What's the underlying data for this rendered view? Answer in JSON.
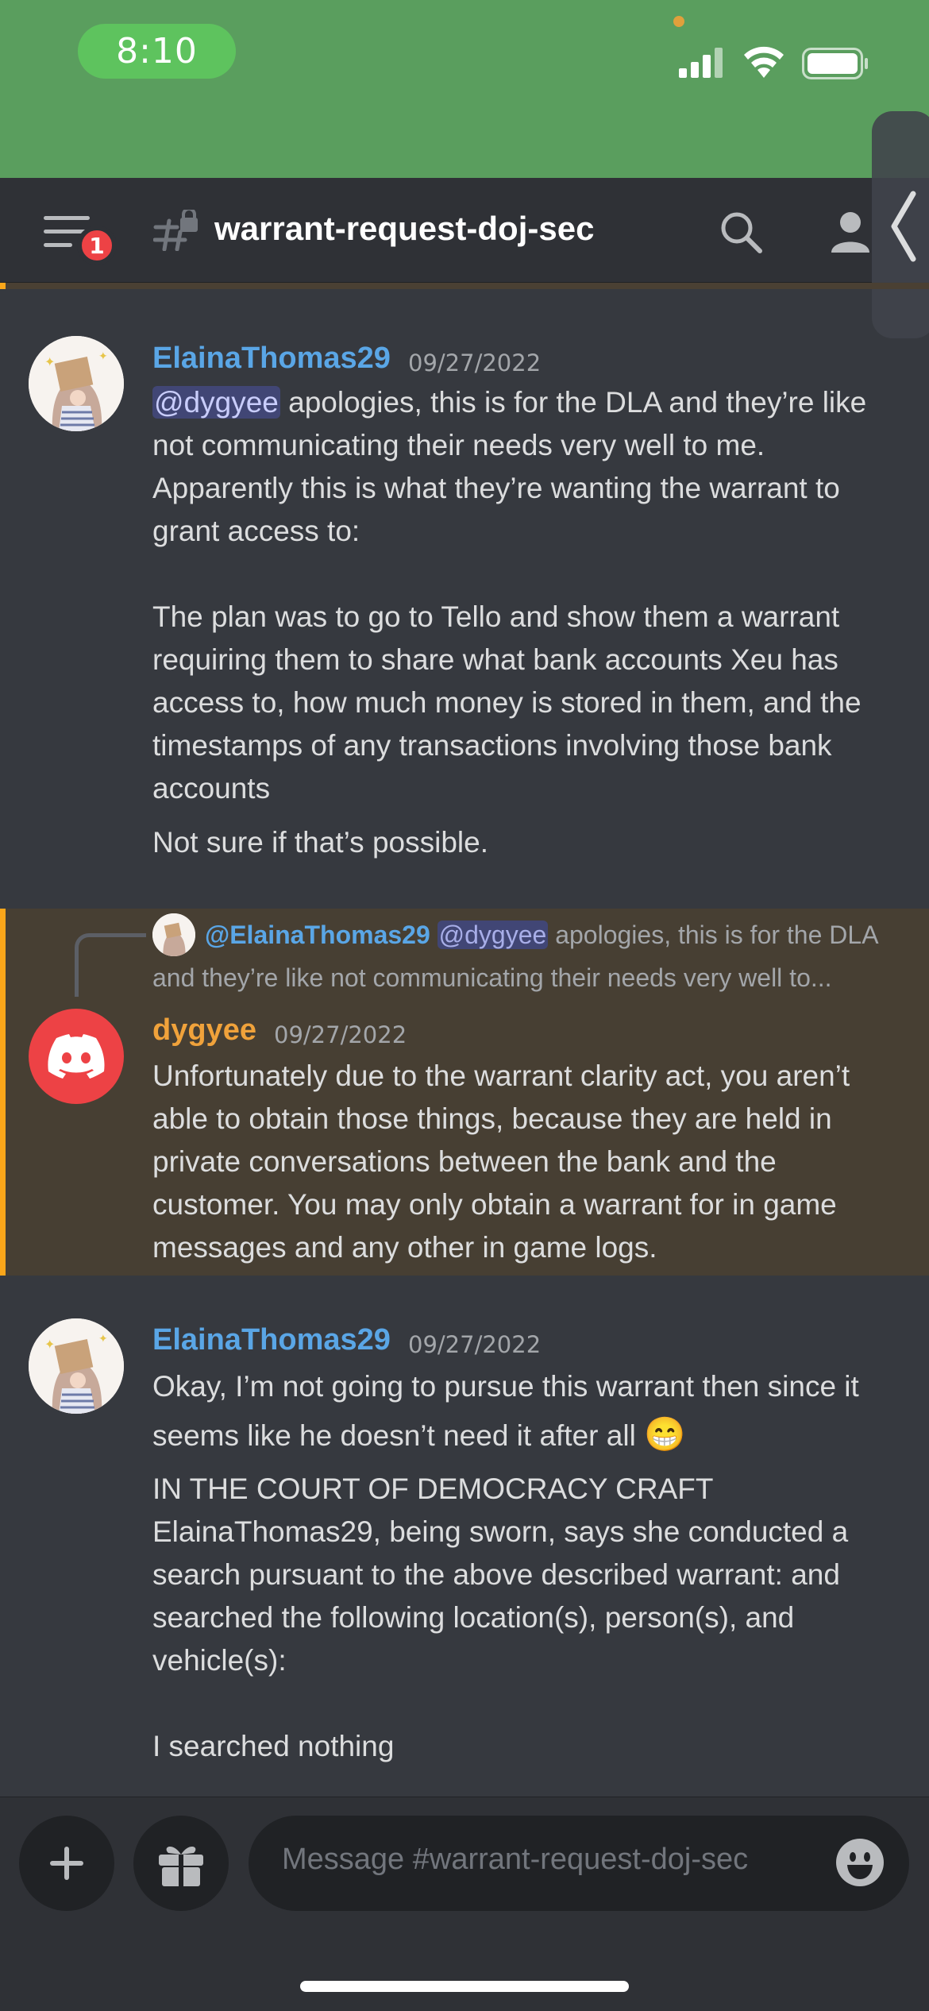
{
  "status_bar": {
    "time": "8:10"
  },
  "header": {
    "notification_count": "1",
    "channel_name": "warrant-request-doj-sec"
  },
  "messages": [
    {
      "author": "ElainaThomas29",
      "author_color": "#5aa6e6",
      "timestamp": "09/27/2022",
      "mention": "@dygyee",
      "text_first": " apologies, this is for the DLA and they’re like not communicating their needs very well to me. Apparently this is what they’re wanting the warrant to grant access to:\n\nThe plan was to go to Tello and show them a warrant requiring them to share what bank accounts Xeu has access to, how much money is stored in them, and the timestamps of any transactions involving those bank accounts",
      "text_second": "Not sure if that’s possible."
    },
    {
      "reply": {
        "author": "@ElainaThomas29",
        "mention": "@dygyee",
        "snippet": " apologies, this is for the DLA and they’re like not communicating their needs very well to..."
      },
      "author": "dygyee",
      "author_color": "#f0a23b",
      "timestamp": "09/27/2022",
      "text": "Unfortunately due to the warrant clarity act, you aren’t able to obtain those things, because they are held in private conversations between the bank and the customer. You may only obtain a warrant for in game messages and any other in game logs."
    },
    {
      "author": "ElainaThomas29",
      "author_color": "#5aa6e6",
      "timestamp": "09/27/2022",
      "text_first": "Okay, I’m not going to pursue this warrant then since it seems like he doesn’t need it after all",
      "emoji": "😁",
      "text_second": "IN THE COURT OF DEMOCRACY CRAFT\nElainaThomas29, being sworn, says she conducted a search pursuant to the above described warrant: and searched the following location(s), person(s), and vehicle(s):\n\nI searched nothing"
    }
  ],
  "composer": {
    "placeholder": "Message #warrant-request-doj-sec"
  }
}
